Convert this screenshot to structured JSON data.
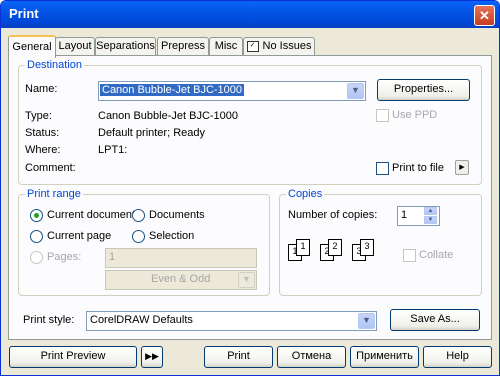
{
  "window": {
    "title": "Print",
    "close_glyph": "✕"
  },
  "tabs": [
    "General",
    "Layout",
    "Separations",
    "Prepress",
    "Misc",
    "No Issues"
  ],
  "destination": {
    "group_label": "Destination",
    "name_label": "Name:",
    "name_value": "Canon Bubble-Jet BJC-1000",
    "properties_button": "Properties...",
    "type_label": "Type:",
    "type_value": "Canon Bubble-Jet BJC-1000",
    "status_label": "Status:",
    "status_value": "Default printer; Ready",
    "where_label": "Where:",
    "where_value": "LPT1:",
    "comment_label": "Comment:",
    "use_ppd_label": "Use PPD",
    "print_to_file_label": "Print to file"
  },
  "print_range": {
    "group_label": "Print range",
    "current_document": "Current document",
    "documents": "Documents",
    "current_page": "Current page",
    "selection": "Selection",
    "pages_label": "Pages:",
    "pages_value": "1",
    "even_odd_value": "Even & Odd",
    "selected": "current_document"
  },
  "copies": {
    "group_label": "Copies",
    "number_label": "Number of copies:",
    "number_value": "1",
    "collate_label": "Collate",
    "collate_icon_pages": [
      "1",
      "1",
      "2",
      "2",
      "3",
      "3"
    ]
  },
  "print_style": {
    "label": "Print style:",
    "value": "CorelDRAW Defaults",
    "save_as_button": "Save As..."
  },
  "footer": {
    "print_preview_button": "Print Preview",
    "print_button": "Print",
    "cancel_button": "Отмена",
    "apply_button": "Применить",
    "help_button": "Help"
  },
  "colors": {
    "title_bar": "#0454e6",
    "group_label": "#0046d5",
    "selection_bg": "#316ac5",
    "dialog_bg": "#ece9d8"
  }
}
